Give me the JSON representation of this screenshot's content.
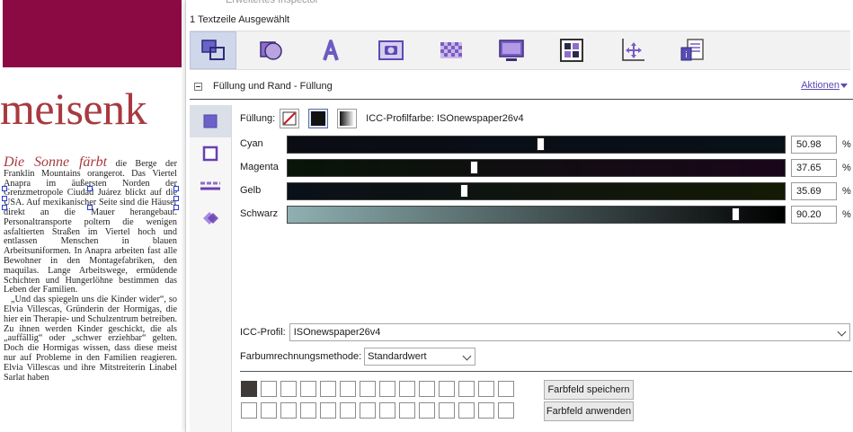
{
  "document": {
    "headline": "meisenk",
    "lead": "Die Sonne färbt",
    "paragraph1": " die Berge der Franklin Mountains orangerot. Das Viertel Anapra im äußersten Norden der Grenzmetropole Ciudad Juárez blickt auf die USA. Auf mexikanischer Seite sind die Häuser direkt an die Mauer herangebaut. Personaltransporte poltern die wenigen asfaltierten Straßen im Viertel hoch und entlassen Menschen in blauen Arbeitsuniformen. In Anapra arbeiten fast alle Bewohner in den Montagefabriken, den maquilas. Lange Arbeitswege, ermüdende Schichten und Hungerlöhne bestimmen das Leben der Familien.",
    "paragraph2": "„Und das spiegeln uns die Kinder wider“, so Elvia Villescas, Gründerin der Hormigas, die hier ein Therapie- und Schulzentrum betreiben. Zu ihnen werden Kinder geschickt, die als „auffällig“ oder „schwer erziehbar“ gelten. Doch die Hormigas wissen, dass diese meist nur auf Probleme in den Familien reagieren. Elvia Villescas und ihre Mitstreiterin Linabel Sarlat haben"
  },
  "panel": {
    "window_title": "Erweitertes Inspector",
    "status": "1 Textzeile Ausgewählt",
    "tabs": [
      {
        "name": "tab-box-icon"
      },
      {
        "name": "tab-shape-icon"
      },
      {
        "name": "tab-text-icon"
      },
      {
        "name": "tab-picture-icon"
      },
      {
        "name": "tab-transparency-icon"
      },
      {
        "name": "tab-display-icon"
      },
      {
        "name": "tab-layout-icon"
      },
      {
        "name": "tab-position-icon"
      },
      {
        "name": "tab-documents-icon"
      }
    ],
    "section_title": "Füllung und Rand - Füllung",
    "actions_label": "Aktionen",
    "fill_label": "Füllung:",
    "icc_profile_color": "ICC-Profilfarbe: ISOnewspaper26v4",
    "channels": [
      {
        "label": "Cyan",
        "value": "50.98",
        "fraction": 0.5098,
        "start": "#0c0c14",
        "end": "#081018",
        "unit": "%"
      },
      {
        "label": "Magenta",
        "value": "37.65",
        "fraction": 0.3765,
        "start": "#081508",
        "end": "#1a061a",
        "unit": "%"
      },
      {
        "label": "Gelb",
        "value": "35.69",
        "fraction": 0.3569,
        "start": "#0a1018",
        "end": "#141a04",
        "unit": "%"
      },
      {
        "label": "Schwarz",
        "value": "90.20",
        "fraction": 0.902,
        "start": "#8fb0b2",
        "end": "#000000",
        "unit": "%"
      }
    ],
    "icc_label": "ICC-Profil:",
    "icc_value": "ISOnewspaper26v4",
    "method_label": "Farbumrechnungsmethode:",
    "method_value": "Standardwert",
    "save_swatch": "Farbfeld speichern",
    "apply_swatch": "Farbfeld anwenden",
    "colors": {
      "accent": "#5a4bb5",
      "banner": "#8b0a43",
      "headline": "#a73a3f",
      "swatch_filled": "#3d3a38"
    }
  }
}
